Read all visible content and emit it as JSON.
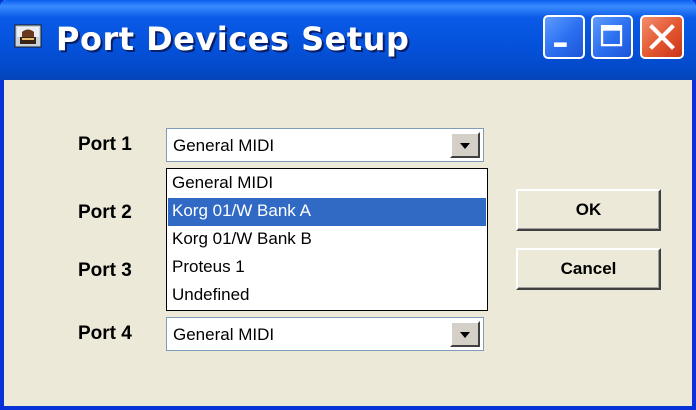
{
  "window": {
    "title": "Port Devices Setup",
    "buttons": {
      "minimize_icon": "minimize-icon",
      "maximize_icon": "maximize-icon",
      "close_icon": "close-icon"
    }
  },
  "ports": [
    {
      "label": "Port 1",
      "value": "General MIDI"
    },
    {
      "label": "Port 2"
    },
    {
      "label": "Port 3"
    },
    {
      "label": "Port 4",
      "value": "General MIDI"
    }
  ],
  "dropdown": {
    "options": [
      "General MIDI",
      "Korg 01/W Bank A",
      "Korg 01/W Bank B",
      "Proteus 1",
      "Undefined"
    ],
    "highlighted": "Korg 01/W Bank A"
  },
  "actions": {
    "ok_label": "OK",
    "cancel_label": "Cancel"
  },
  "colors": {
    "titlebar": "#0451D9",
    "face": "#ECE9D8",
    "selection": "#316AC5",
    "close": "#E2552E"
  }
}
